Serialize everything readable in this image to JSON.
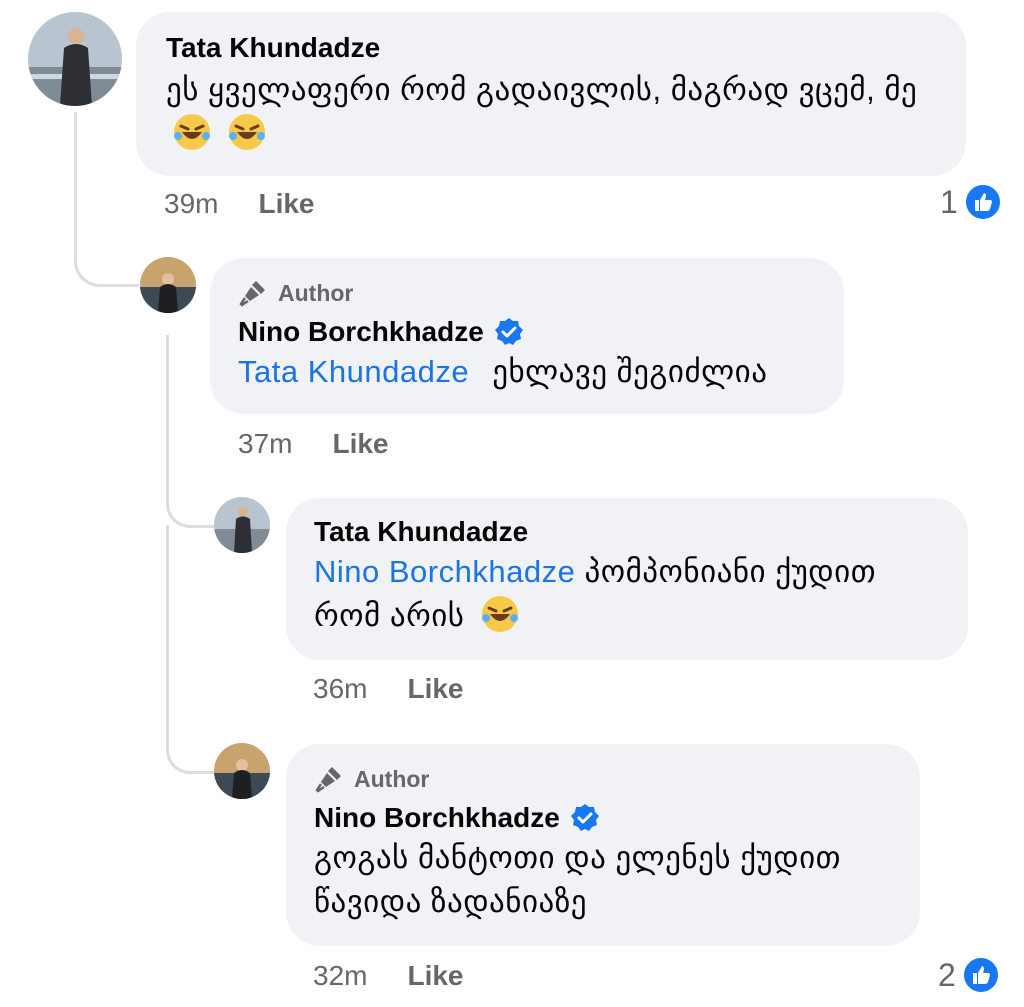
{
  "comments": [
    {
      "author": "Tata Khundadze",
      "text": "ეს ყველაფერი რომ გადაივლის, მაგრად ვცემ, მე",
      "emoji": "rolling-on-floor-laughing x2",
      "time": "39m",
      "like_label": "Like",
      "reaction_count": "1"
    },
    {
      "author_badge": "Author",
      "author": "Nino Borchkhadze",
      "verified": true,
      "mention": "Tata Khundadze",
      "text": "ეხლავე შეგიძლია",
      "time": "37m",
      "like_label": "Like"
    },
    {
      "author": "Tata Khundadze",
      "mention": "Nino Borchkhadze",
      "text_line1": "პომპონიანი ქუდით",
      "text_line2": "რომ არის",
      "emoji": "rolling-on-floor-laughing",
      "time": "36m",
      "like_label": "Like"
    },
    {
      "author_badge": "Author",
      "author": "Nino Borchkhadze",
      "verified": true,
      "text_line1": "გოგას მანტოთი და ელენეს ქუდით",
      "text_line2": "წავიდა ზადანიაზე",
      "time": "32m",
      "like_label": "Like",
      "reaction_count": "2"
    }
  ],
  "icons": {
    "author": "microphone-icon",
    "verified": "verified-badge-icon",
    "reaction": "like-reaction-icon"
  },
  "colors": {
    "bubble": "#f0f2f5",
    "mention": "#1b74e4",
    "meta": "#65676b",
    "like_blue": "#1877f2"
  }
}
